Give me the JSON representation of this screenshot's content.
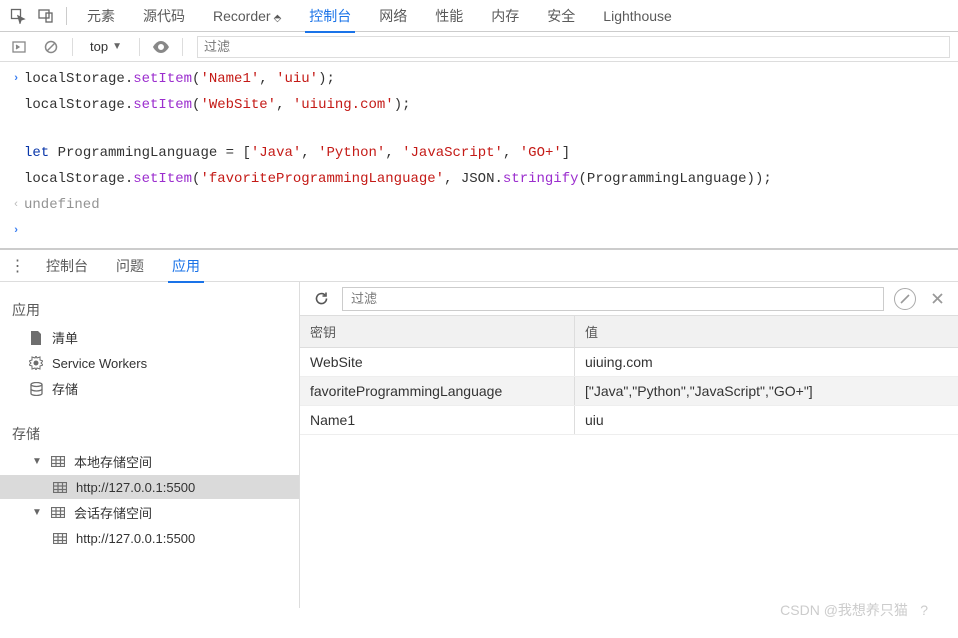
{
  "topTabs": {
    "elements": "元素",
    "sources": "源代码",
    "recorder": "Recorder",
    "console": "控制台",
    "network": "网络",
    "performance": "性能",
    "memory": "内存",
    "security": "安全",
    "lighthouse": "Lighthouse"
  },
  "consoleToolbar": {
    "context": "top",
    "filterPlaceholder": "过滤"
  },
  "consoleCode": {
    "l1a": "localStorage.",
    "l1b": "setItem",
    "l1c": "(",
    "l1d": "'Name1'",
    "l1e": ", ",
    "l1f": "'uiu'",
    "l1g": ");",
    "l2a": "localStorage.",
    "l2b": "setItem",
    "l2c": "(",
    "l2d": "'WebSite'",
    "l2e": ", ",
    "l2f": "'uiuing.com'",
    "l2g": ");",
    "l3a": "let",
    "l3b": " ProgrammingLanguage = [",
    "l3c": "'Java'",
    "l3d": ", ",
    "l3e": "'Python'",
    "l3f": ", ",
    "l3g": "'JavaScript'",
    "l3h": ", ",
    "l3i": "'GO+'",
    "l3j": "]",
    "l4a": "localStorage.",
    "l4b": "setItem",
    "l4c": "(",
    "l4d": "'favoriteProgrammingLanguage'",
    "l4e": ", JSON.",
    "l4f": "stringify",
    "l4g": "(ProgrammingLanguage));",
    "undefined": "undefined"
  },
  "drawerTabs": {
    "console": "控制台",
    "issues": "问题",
    "application": "应用"
  },
  "sidebar": {
    "appSection": "应用",
    "manifest": "清单",
    "serviceWorkers": "Service Workers",
    "storage": "存储",
    "storageSection": "存储",
    "localStorage": "本地存储空间",
    "localUrl": "http://127.0.0.1:5500",
    "sessionStorage": "会话存储空间",
    "sessionUrl": "http://127.0.0.1:5500"
  },
  "appToolbar": {
    "filterPlaceholder": "过滤"
  },
  "storageTable": {
    "keyHeader": "密钥",
    "valueHeader": "值",
    "rows": [
      {
        "key": "WebSite",
        "value": "uiuing.com"
      },
      {
        "key": "favoriteProgrammingLanguage",
        "value": "[\"Java\",\"Python\",\"JavaScript\",\"GO+\"]"
      },
      {
        "key": "Name1",
        "value": "uiu"
      }
    ]
  },
  "watermark": "CSDN @我想养只猫    ?"
}
